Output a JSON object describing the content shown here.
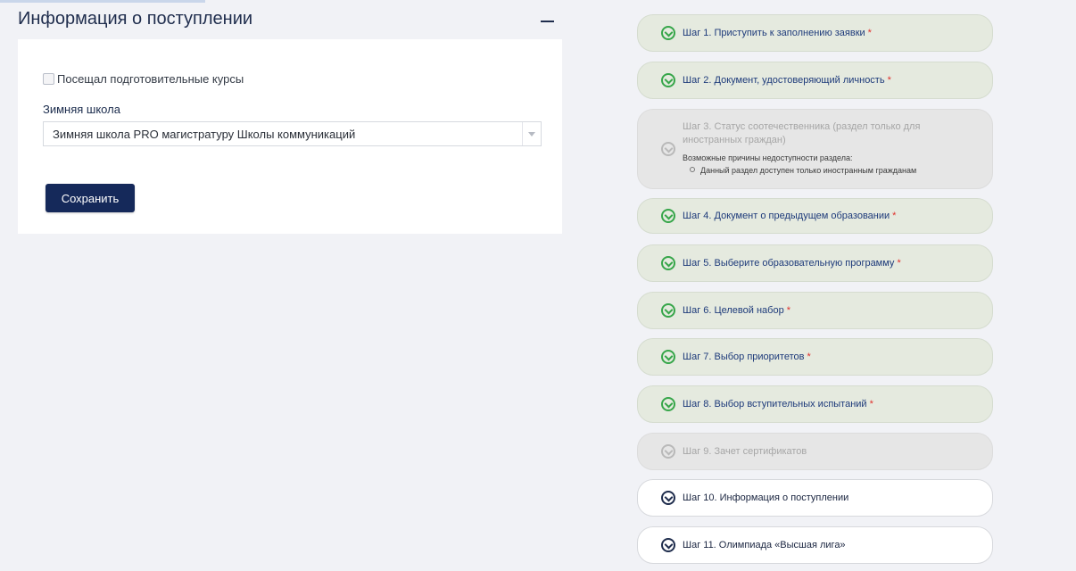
{
  "section": {
    "title": "Информация о поступлении"
  },
  "form": {
    "courses_checkbox_label": "Посещал подготовительные курсы",
    "winter_school_label": "Зимняя школа",
    "winter_school_value": "Зимняя школа PRO магистратуру Школы коммуникаций",
    "save_label": "Сохранить"
  },
  "steps": [
    {
      "label": "Шаг 1. Приступить к заполнению заявки",
      "required": "*",
      "status": "done"
    },
    {
      "label": "Шаг 2. Документ, удостоверяющий личность",
      "required": "*",
      "status": "done"
    },
    {
      "label": "Шаг 3. Статус соотечественника (раздел только для иностранных граждан)",
      "status": "disabled",
      "note_title": "Возможные причины недоступности раздела:",
      "note_item": "Данный раздел доступен только иностранным гражданам"
    },
    {
      "label": "Шаг 4. Документ о предыдущем образовании",
      "required": "*",
      "status": "done"
    },
    {
      "label": "Шаг 5. Выберите образовательную программу",
      "required": "*",
      "status": "done"
    },
    {
      "label": "Шаг 6. Целевой набор",
      "required": "*",
      "status": "done"
    },
    {
      "label": "Шаг 7. Выбор приоритетов",
      "required": "*",
      "status": "done"
    },
    {
      "label": "Шаг 8. Выбор вступительных испытаний",
      "required": "*",
      "status": "done"
    },
    {
      "label": "Шаг 9. Зачет сертификатов",
      "status": "disabled"
    },
    {
      "label": "Шаг 10. Информация о поступлении",
      "status": "todo"
    },
    {
      "label": "Шаг 11. Олимпиада «Высшая лига»",
      "status": "todo"
    }
  ],
  "colors": {
    "accent": "#15295a",
    "done_bg": "#e5eadf",
    "check_green": "#37a64a",
    "required_red": "#e0302c"
  }
}
